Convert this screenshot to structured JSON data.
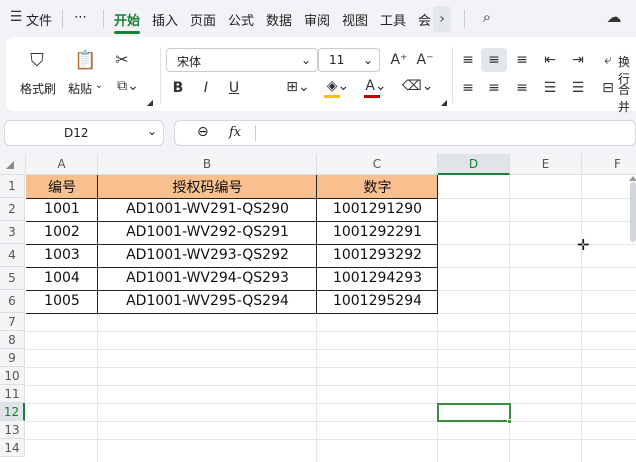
{
  "menu": {
    "file": "文件",
    "more": "⋯",
    "tabs": [
      "开始",
      "插入",
      "页面",
      "公式",
      "数据",
      "审阅",
      "视图",
      "工具",
      "会"
    ],
    "active_tab": "开始"
  },
  "ribbon": {
    "format_painter": "格式刷",
    "paste": "粘贴",
    "font_name": "宋体",
    "font_size": "11",
    "wrap": "换行",
    "merge": "合并"
  },
  "formula_bar": {
    "name_box": "D12",
    "fx": "fx",
    "formula": ""
  },
  "sheet": {
    "columns": [
      "A",
      "B",
      "C",
      "D",
      "E",
      "F"
    ],
    "selected_column": "D",
    "rows": [
      "1",
      "2",
      "3",
      "4",
      "5",
      "6",
      "7",
      "8",
      "9",
      "10",
      "11",
      "12",
      "13",
      "14"
    ],
    "selected_row": "12",
    "header": [
      "编号",
      "授权码编号",
      "数字"
    ],
    "data": [
      [
        "1001",
        "AD1001-WV291-QS290",
        "1001291290"
      ],
      [
        "1002",
        "AD1001-WV292-QS291",
        "1001292291"
      ],
      [
        "1003",
        "AD1001-WV293-QS292",
        "1001293292"
      ],
      [
        "1004",
        "AD1001-WV294-QS293",
        "1001294293"
      ],
      [
        "1005",
        "AD1001-WV295-QS294",
        "1001295294"
      ]
    ]
  },
  "colors": {
    "accent": "#1a7f37",
    "header_fill": "#f8c08e",
    "selection": "#3b8f3b"
  }
}
